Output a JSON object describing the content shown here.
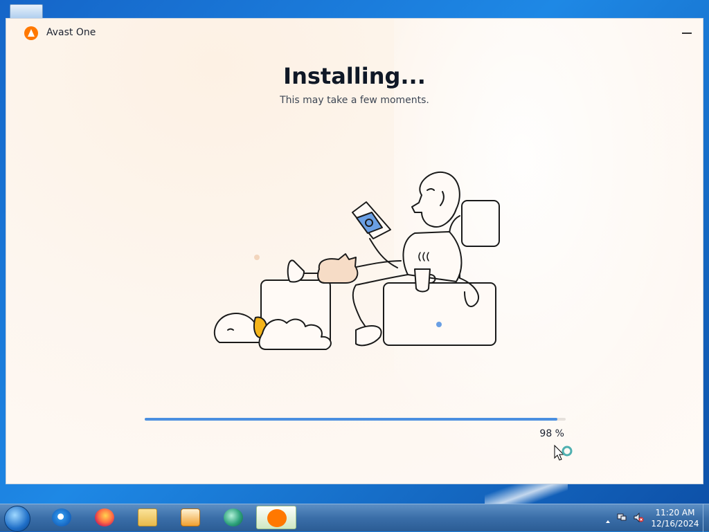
{
  "window": {
    "app_title": "Avast One",
    "heading": "Installing...",
    "subheading": "This may take a few moments.",
    "progress_percent": 98,
    "progress_label": "98 %"
  },
  "taskbar": {
    "items": [
      "ie-icon",
      "firefox-icon",
      "folder-icon",
      "media-player-icon",
      "app-icon",
      "avast-icon"
    ],
    "clock_time": "11:20 AM",
    "clock_date": "12/16/2024"
  },
  "colors": {
    "accent": "#4b8fe0",
    "brand": "#ff7800"
  }
}
